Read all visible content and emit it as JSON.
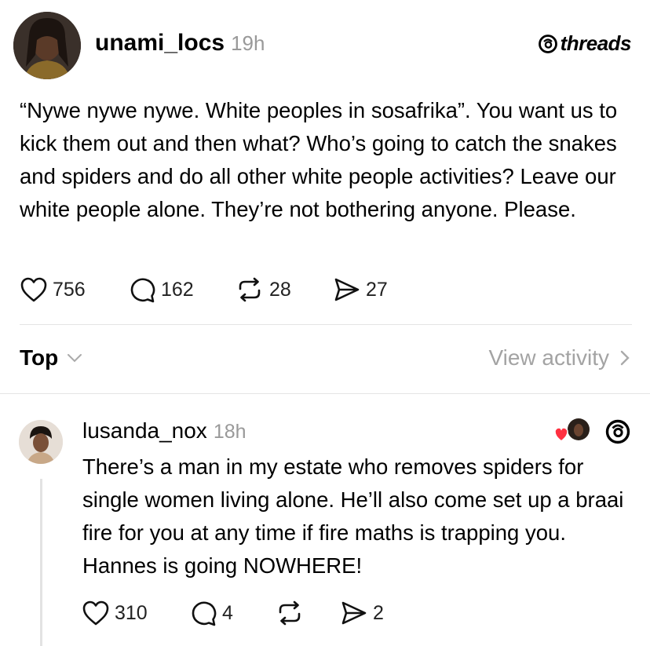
{
  "post": {
    "username": "unami_locs",
    "time": "19h",
    "text": "“Nywe nywe nywe. White peoples in sosafrika”. You want us to kick them out and then what? Who’s going to catch the snakes and spiders and do all other white people activities? Leave our white people alone. They’re not bothering anyone. Please.",
    "likes": "756",
    "comments": "162",
    "reposts": "28",
    "shares": "27"
  },
  "brand": {
    "name": "threads"
  },
  "sort": {
    "label": "Top"
  },
  "activity": {
    "label": "View activity"
  },
  "reply": {
    "username": "lusanda_nox",
    "time": "18h",
    "text": "There’s a man in my estate who removes spiders for single women living alone. He’ll also come set up a braai fire for you at any time if fire maths is trapping you. Hannes is going NOWHERE!",
    "likes": "310",
    "comments": "4",
    "shares": "2"
  },
  "colors": {
    "like_heart": "#ff3040",
    "muted": "#999999"
  }
}
